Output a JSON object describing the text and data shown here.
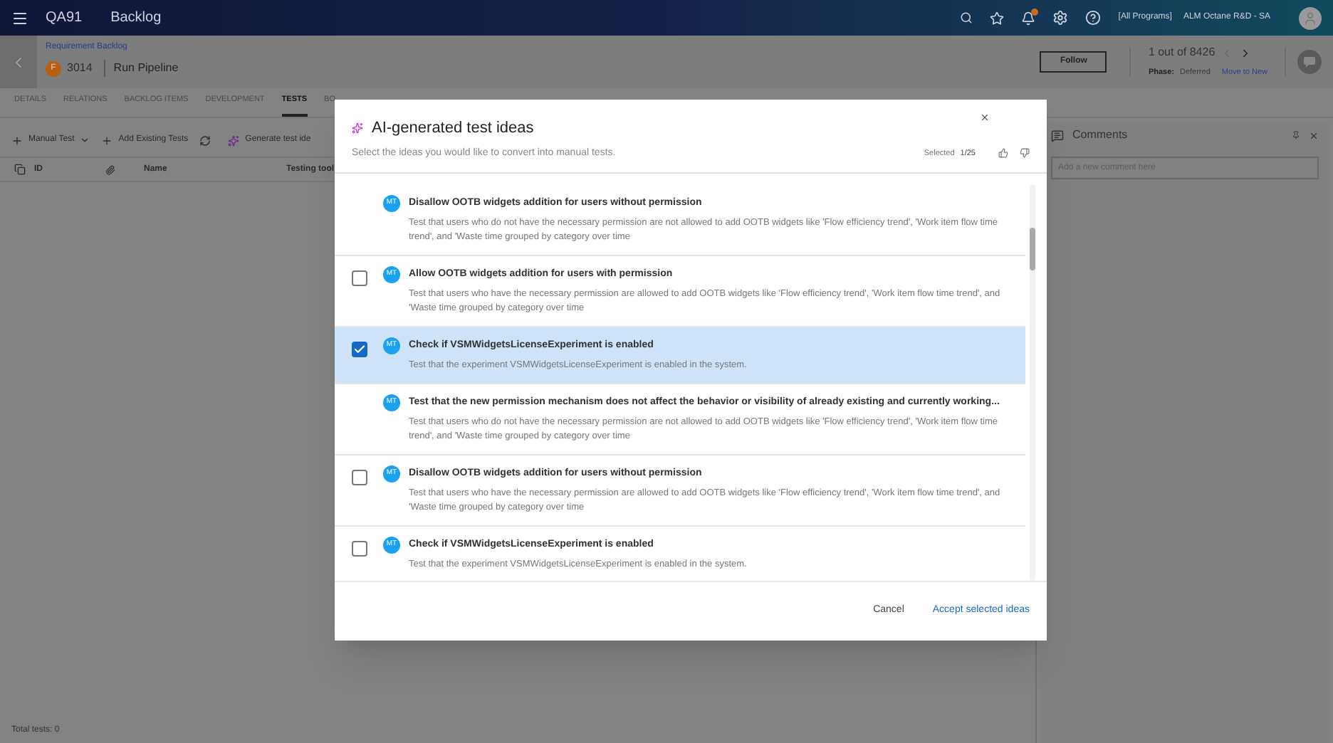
{
  "top_bar": {
    "workspace": "QA91",
    "module": "Backlog",
    "context": "[All Programs]",
    "workspace_name": "ALM Octane R&D - SA"
  },
  "header": {
    "breadcrumb": "Requirement Backlog",
    "type_badge": "F",
    "id": "3014",
    "title": "Run Pipeline",
    "follow": "Follow",
    "counter": "1 out of 8426",
    "phase_label": "Phase:",
    "phase_value": "Deferred",
    "move_link": "Move to New"
  },
  "tabs": [
    {
      "label": "DETAILS",
      "selected": false
    },
    {
      "label": "RELATIONS",
      "selected": false
    },
    {
      "label": "BACKLOG ITEMS",
      "selected": false
    },
    {
      "label": "DEVELOPMENT",
      "selected": false
    },
    {
      "label": "TESTS",
      "selected": true
    },
    {
      "label": "BO",
      "selected": false
    }
  ],
  "toolbar": {
    "manual_test": "Manual Test",
    "add_existing": "Add Existing Tests",
    "generate": "Generate test ide"
  },
  "table": {
    "columns": [
      "ID",
      "Name",
      "Testing tool"
    ],
    "footer": "Total tests: 0"
  },
  "comments": {
    "title": "Comments",
    "placeholder": "Add a new comment here"
  },
  "dialog": {
    "title": "AI-generated test ideas",
    "subtitle": "Select the ideas you would like to convert into manual tests.",
    "selected_label": "Selected",
    "selected_count": "1/25",
    "ideas": [
      {
        "kind": "plain",
        "avatar": "MT",
        "title": "Disallow OOTB widgets addition for users without permission",
        "description": "Test that users who do not have the necessary permission are not allowed to add OOTB widgets like 'Flow efficiency trend', 'Work item flow time trend', and 'Waste time grouped by category over time"
      },
      {
        "kind": "checkbox",
        "selected": false,
        "avatar": "MT",
        "title": "Allow OOTB widgets addition for users with permission",
        "description": "Test that users who have the necessary permission are allowed to add OOTB widgets like 'Flow efficiency trend', 'Work item flow time trend', and 'Waste time grouped by category over time"
      },
      {
        "kind": "checkbox",
        "selected": true,
        "avatar": "MT",
        "title": "Check if VSMWidgetsLicenseExperiment is enabled",
        "description": "Test that the experiment VSMWidgetsLicenseExperiment is enabled in the system."
      },
      {
        "kind": "plain",
        "avatar": "MT",
        "title": "Test that the new permission mechanism does not affect the behavior or visibility of already existing and currently working...",
        "description": "Test that users who do not have the necessary permission are not allowed to add OOTB widgets like 'Flow efficiency trend', 'Work item flow time trend', and 'Waste time grouped by category over time"
      },
      {
        "kind": "checkbox",
        "selected": false,
        "avatar": "MT",
        "title": "Disallow OOTB widgets addition for users without permission",
        "description": "Test that users who have the necessary permission are allowed to add OOTB widgets like 'Flow efficiency trend', 'Work item flow time trend', and 'Waste time grouped by category over time"
      },
      {
        "kind": "checkbox",
        "selected": false,
        "avatar": "MT",
        "title": "Check if VSMWidgetsLicenseExperiment is enabled",
        "description": "Test that the experiment VSMWidgetsLicenseExperiment is enabled in the system."
      }
    ],
    "cancel": "Cancel",
    "accept": "Accept selected ideas"
  }
}
